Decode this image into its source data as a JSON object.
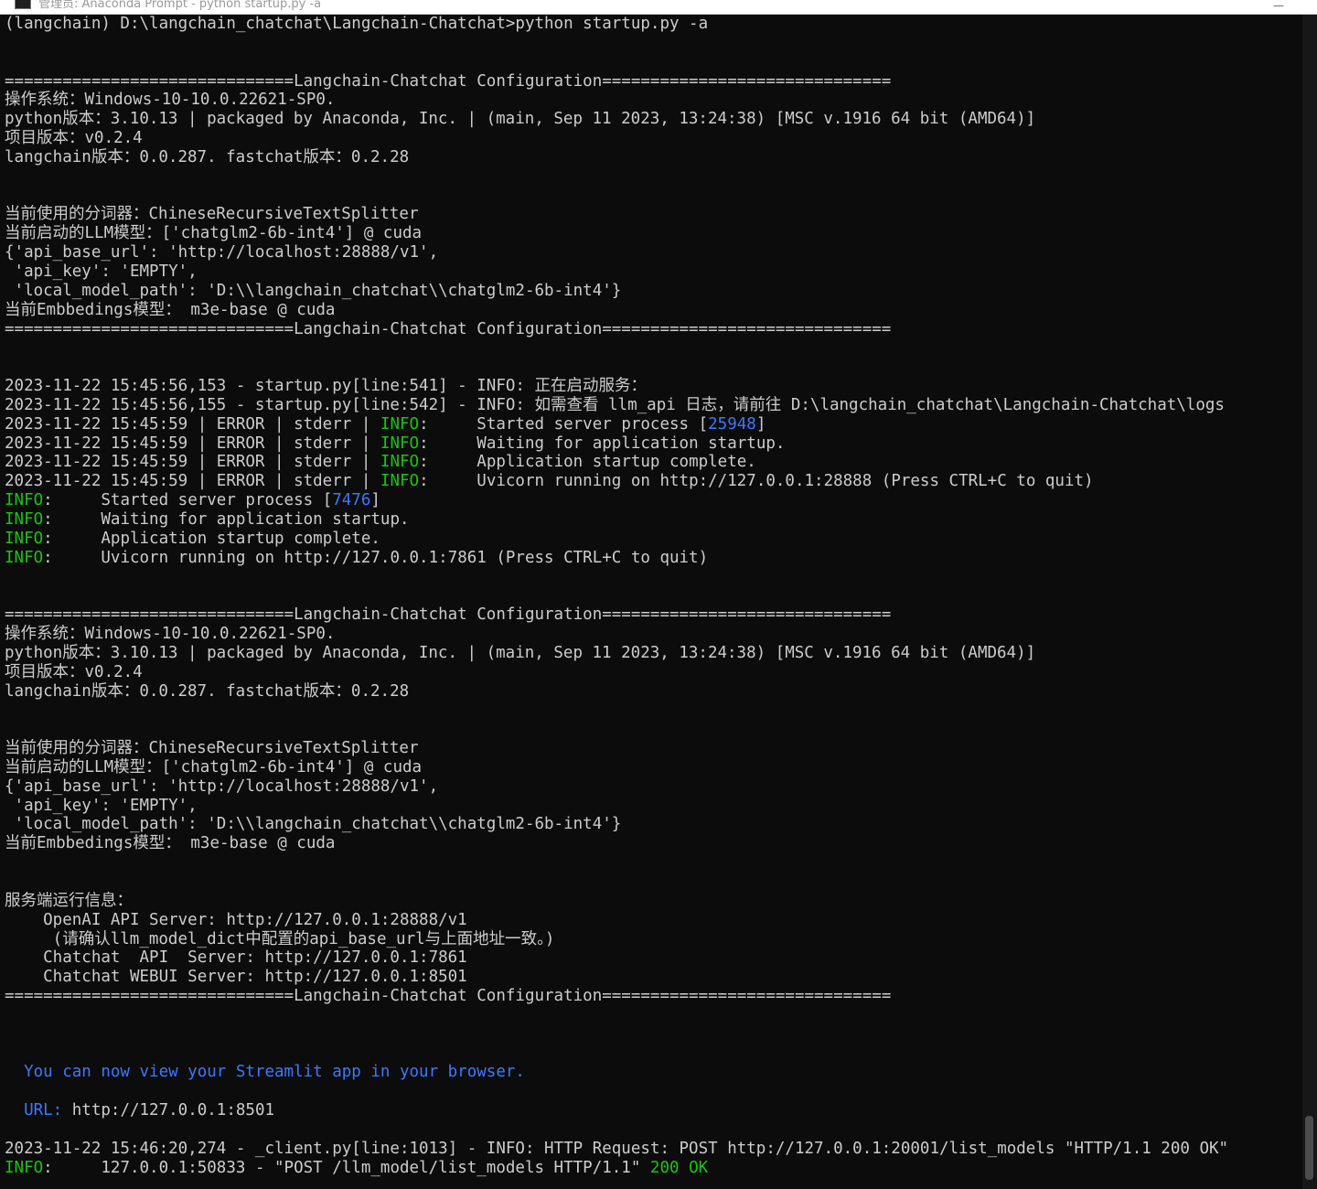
{
  "window": {
    "title": "管理员: Anaconda Prompt - python startup.py -a",
    "minimize_glyph": "—"
  },
  "colors": {
    "background": "#0c0c0c",
    "text": "#cccccc",
    "info_green": "#16c60c",
    "link_blue": "#3b78ff"
  },
  "lines": [
    [
      {
        "t": "(langchain) D:\\langchain_chatchat\\Langchain-Chatchat>python startup.py -a"
      }
    ],
    [],
    [],
    [
      {
        "t": "==============================Langchain-Chatchat Configuration=============================="
      }
    ],
    [
      {
        "t": "操作系统：Windows-10-10.0.22621-SP0."
      }
    ],
    [
      {
        "t": "python版本：3.10.13 | packaged by Anaconda, Inc. | (main, Sep 11 2023, 13:24:38) [MSC v.1916 64 bit (AMD64)]"
      }
    ],
    [
      {
        "t": "项目版本：v0.2.4"
      }
    ],
    [
      {
        "t": "langchain版本：0.0.287. fastchat版本：0.2.28"
      }
    ],
    [],
    [],
    [
      {
        "t": "当前使用的分词器：ChineseRecursiveTextSplitter"
      }
    ],
    [
      {
        "t": "当前启动的LLM模型：['chatglm2-6b-int4'] @ cuda"
      }
    ],
    [
      {
        "t": "{'api_base_url': 'http://localhost:28888/v1',"
      }
    ],
    [
      {
        "t": " 'api_key': 'EMPTY',"
      }
    ],
    [
      {
        "t": " 'local_model_path': 'D:\\\\langchain_chatchat\\\\chatglm2-6b-int4'}"
      }
    ],
    [
      {
        "t": "当前Embbedings模型： m3e-base @ cuda"
      }
    ],
    [
      {
        "t": "==============================Langchain-Chatchat Configuration=============================="
      }
    ],
    [],
    [],
    [
      {
        "t": "2023-11-22 15:45:56,153 - startup.py[line:541] - INFO: 正在启动服务："
      }
    ],
    [
      {
        "t": "2023-11-22 15:45:56,155 - startup.py[line:542] - INFO: 如需查看 llm_api 日志，请前往 D:\\langchain_chatchat\\Langchain-Chatchat\\logs"
      }
    ],
    [
      {
        "t": "2023-11-22 15:45:59 | ERROR | stderr | "
      },
      {
        "t": "INFO",
        "c": "g"
      },
      {
        "t": ":     Started server process ["
      },
      {
        "t": "25948",
        "c": "b"
      },
      {
        "t": "]"
      }
    ],
    [
      {
        "t": "2023-11-22 15:45:59 | ERROR | stderr | "
      },
      {
        "t": "INFO",
        "c": "g"
      },
      {
        "t": ":     Waiting for application startup."
      }
    ],
    [
      {
        "t": "2023-11-22 15:45:59 | ERROR | stderr | "
      },
      {
        "t": "INFO",
        "c": "g"
      },
      {
        "t": ":     Application startup complete."
      }
    ],
    [
      {
        "t": "2023-11-22 15:45:59 | ERROR | stderr | "
      },
      {
        "t": "INFO",
        "c": "g"
      },
      {
        "t": ":     Uvicorn running on http://127.0.0.1:28888 (Press CTRL+C to quit)"
      }
    ],
    [
      {
        "t": "INFO",
        "c": "g"
      },
      {
        "t": ":     Started server process ["
      },
      {
        "t": "7476",
        "c": "b"
      },
      {
        "t": "]"
      }
    ],
    [
      {
        "t": "INFO",
        "c": "g"
      },
      {
        "t": ":     Waiting for application startup."
      }
    ],
    [
      {
        "t": "INFO",
        "c": "g"
      },
      {
        "t": ":     Application startup complete."
      }
    ],
    [
      {
        "t": "INFO",
        "c": "g"
      },
      {
        "t": ":     Uvicorn running on http://127.0.0.1:7861 (Press CTRL+C to quit)"
      }
    ],
    [],
    [],
    [
      {
        "t": "==============================Langchain-Chatchat Configuration=============================="
      }
    ],
    [
      {
        "t": "操作系统：Windows-10-10.0.22621-SP0."
      }
    ],
    [
      {
        "t": "python版本：3.10.13 | packaged by Anaconda, Inc. | (main, Sep 11 2023, 13:24:38) [MSC v.1916 64 bit (AMD64)]"
      }
    ],
    [
      {
        "t": "项目版本：v0.2.4"
      }
    ],
    [
      {
        "t": "langchain版本：0.0.287. fastchat版本：0.2.28"
      }
    ],
    [],
    [],
    [
      {
        "t": "当前使用的分词器：ChineseRecursiveTextSplitter"
      }
    ],
    [
      {
        "t": "当前启动的LLM模型：['chatglm2-6b-int4'] @ cuda"
      }
    ],
    [
      {
        "t": "{'api_base_url': 'http://localhost:28888/v1',"
      }
    ],
    [
      {
        "t": " 'api_key': 'EMPTY',"
      }
    ],
    [
      {
        "t": " 'local_model_path': 'D:\\\\langchain_chatchat\\\\chatglm2-6b-int4'}"
      }
    ],
    [
      {
        "t": "当前Embbedings模型： m3e-base @ cuda"
      }
    ],
    [],
    [],
    [
      {
        "t": "服务端运行信息："
      }
    ],
    [
      {
        "t": "    OpenAI API Server: http://127.0.0.1:28888/v1"
      }
    ],
    [
      {
        "t": "     (请确认llm_model_dict中配置的api_base_url与上面地址一致。)"
      }
    ],
    [
      {
        "t": "    Chatchat  API  Server: http://127.0.0.1:7861"
      }
    ],
    [
      {
        "t": "    Chatchat WEBUI Server: http://127.0.0.1:8501"
      }
    ],
    [
      {
        "t": "==============================Langchain-Chatchat Configuration=============================="
      }
    ],
    [],
    [],
    [],
    [
      {
        "t": "  You can now view your Streamlit app in your browser.",
        "c": "b"
      }
    ],
    [],
    [
      {
        "t": "  URL: ",
        "c": "b"
      },
      {
        "t": "http://127.0.0.1:8501"
      }
    ],
    [],
    [
      {
        "t": "2023-11-22 15:46:20,274 - _client.py[line:1013] - INFO: HTTP Request: POST http://127.0.0.1:20001/list_models \"HTTP/1.1 200 OK\""
      }
    ],
    [
      {
        "t": "INFO",
        "c": "g"
      },
      {
        "t": ":     127.0.0.1:50833 - \"POST /llm_model/list_models HTTP/1.1\" "
      },
      {
        "t": "200 OK",
        "c": "g"
      }
    ]
  ]
}
